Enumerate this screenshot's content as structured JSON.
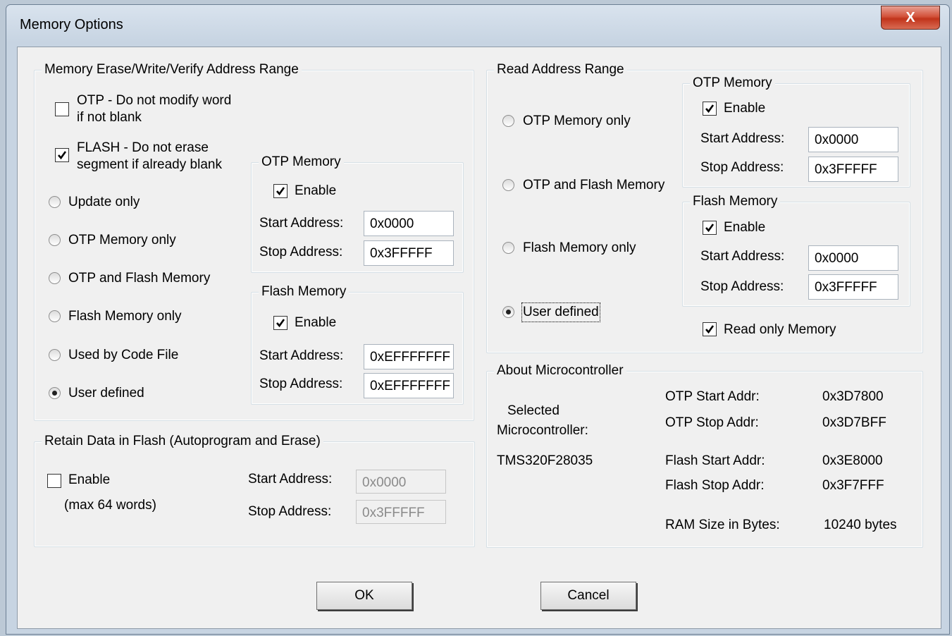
{
  "window": {
    "title": "Memory Options",
    "close_label": "X"
  },
  "erase_group": {
    "title": "Memory Erase/Write/Verify Address Range",
    "otp_nomodify": {
      "line1": "OTP - Do not modify word",
      "line2": "if not blank",
      "checked": false
    },
    "flash_noerase": {
      "line1": "FLASH - Do not erase",
      "line2": "segment if already blank",
      "checked": true
    },
    "radios": [
      "Update only",
      "OTP Memory only",
      "OTP and Flash Memory",
      "Flash Memory only",
      "Used by Code File",
      "User defined"
    ],
    "selected": "User defined",
    "otp": {
      "title": "OTP Memory",
      "enable": "Enable",
      "start_label": "Start Address:",
      "start": "0x0000",
      "stop_label": "Stop Address:",
      "stop": "0x3FFFFF"
    },
    "flash": {
      "title": "Flash Memory",
      "enable": "Enable",
      "start_label": "Start Address:",
      "start": "0xEFFFFFFF",
      "stop_label": "Stop Address:",
      "stop": "0xEFFFFFFF"
    }
  },
  "retain_group": {
    "title": "Retain Data in Flash   (Autoprogram and Erase)",
    "enable": "Enable",
    "note": "(max 64 words)",
    "start_label": "Start Address:",
    "start": "0x0000",
    "stop_label": "Stop Address:",
    "stop": "0x3FFFFF"
  },
  "read_group": {
    "title": "Read Address Range",
    "radios": [
      "OTP Memory only",
      "OTP and Flash Memory",
      "Flash Memory only",
      "User defined"
    ],
    "selected": "User defined",
    "otp": {
      "title": "OTP Memory",
      "enable": "Enable",
      "start_label": "Start Address:",
      "start": "0x0000",
      "stop_label": "Stop Address:",
      "stop": "0x3FFFFF"
    },
    "flash": {
      "title": "Flash Memory",
      "enable": "Enable",
      "start_label": "Start Address:",
      "start": "0x0000",
      "stop_label": "Stop Address:",
      "stop": "0x3FFFFF"
    },
    "read_only": "Read only Memory"
  },
  "about_group": {
    "title": "About Microcontroller",
    "selected_line1": "Selected",
    "selected_line2": "Microcontroller:",
    "device": "TMS320F28035",
    "otp_start_label": "OTP Start Addr:",
    "otp_start": "0x3D7800",
    "otp_stop_label": "OTP Stop Addr:",
    "otp_stop": "0x3D7BFF",
    "flash_start_label": "Flash Start Addr:",
    "flash_start": "0x3E8000",
    "flash_stop_label": "Flash Stop Addr:",
    "flash_stop": "0x3F7FFF",
    "ram_label": "RAM Size in Bytes:",
    "ram": "10240  bytes"
  },
  "buttons": {
    "ok": "OK",
    "cancel": "Cancel"
  }
}
